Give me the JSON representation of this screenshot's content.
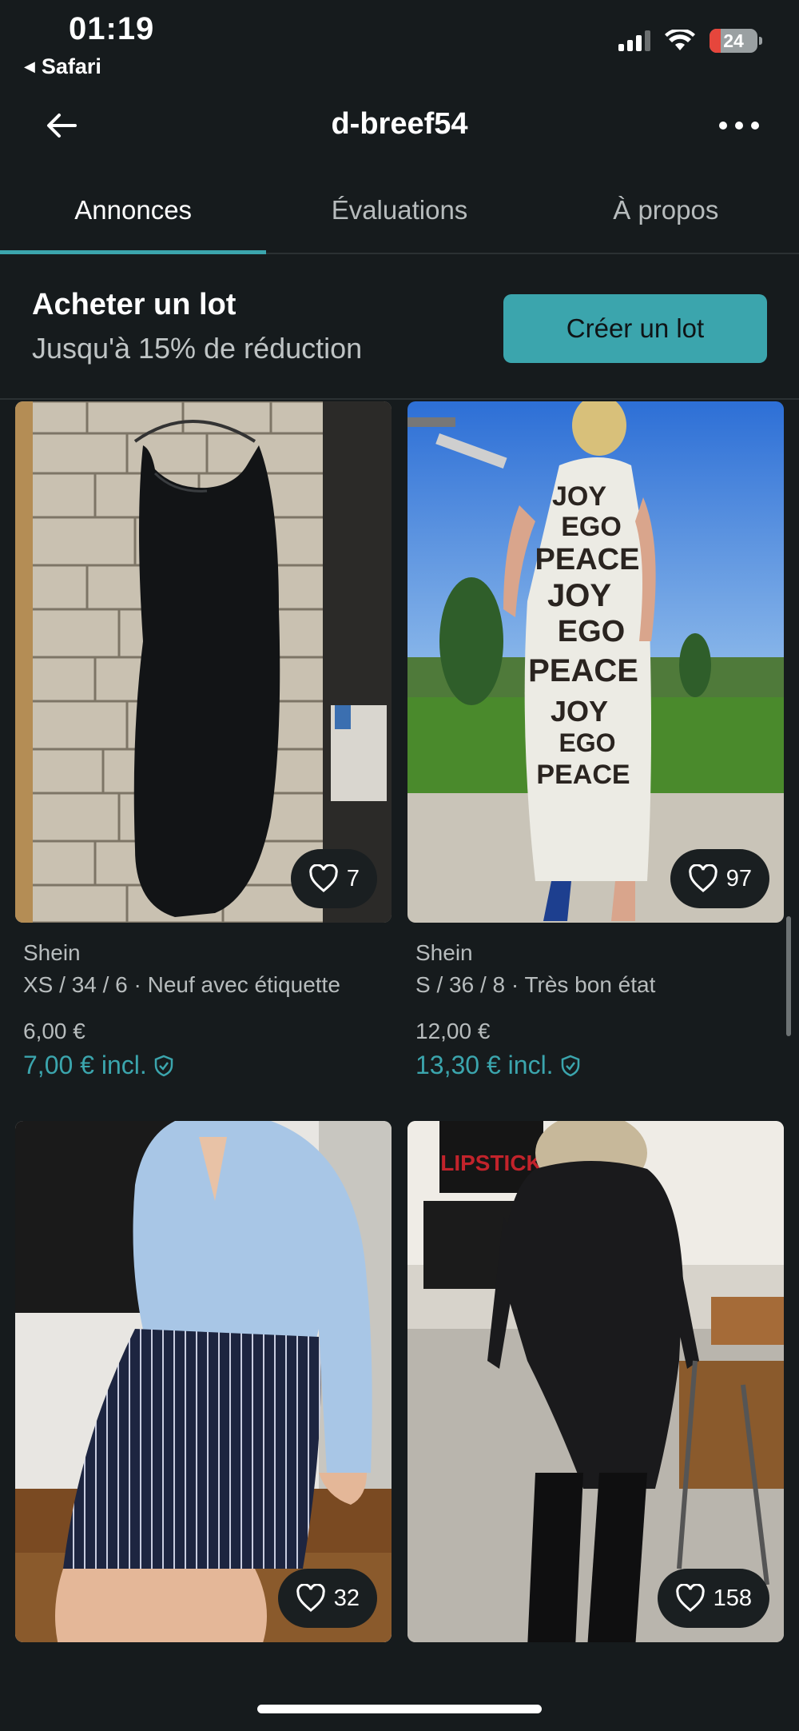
{
  "status_bar": {
    "time": "01:19",
    "back_app": "Safari",
    "battery": "24",
    "icons": [
      "cellular-signal-icon",
      "wifi-icon",
      "battery-icon"
    ]
  },
  "nav": {
    "title": "d-breef54",
    "back_icon": "arrow-left-icon",
    "more_icon": "more-dots-icon"
  },
  "tabs": [
    {
      "label": "Annonces",
      "active": true
    },
    {
      "label": "Évaluations",
      "active": false
    },
    {
      "label": "À propos",
      "active": false
    }
  ],
  "bundle": {
    "title": "Acheter un lot",
    "subtitle": "Jusqu'à 15% de réduction",
    "button": "Créer un lot"
  },
  "colors": {
    "background": "#161b1d",
    "accent": "#3ba5ad",
    "text_secondary": "#b7bcbd"
  },
  "items": [
    {
      "brand": "Shein",
      "details": "XS / 34 / 6 · Neuf avec étiquette",
      "price": "6,00 €",
      "price_incl": "7,00 € incl.",
      "favorites": "7"
    },
    {
      "brand": "Shein",
      "details": "S / 36 / 8 · Très bon état",
      "price": "12,00 €",
      "price_incl": "13,30 € incl.",
      "favorites": "97",
      "print_text": [
        "JOY",
        "EGO",
        "PEACE",
        "JOY",
        "EGO",
        "PEACE",
        "JOY",
        "EGO",
        "PEACE"
      ]
    },
    {
      "favorites": "32"
    },
    {
      "favorites": "158",
      "sign_text": "LIPSTICK"
    }
  ]
}
